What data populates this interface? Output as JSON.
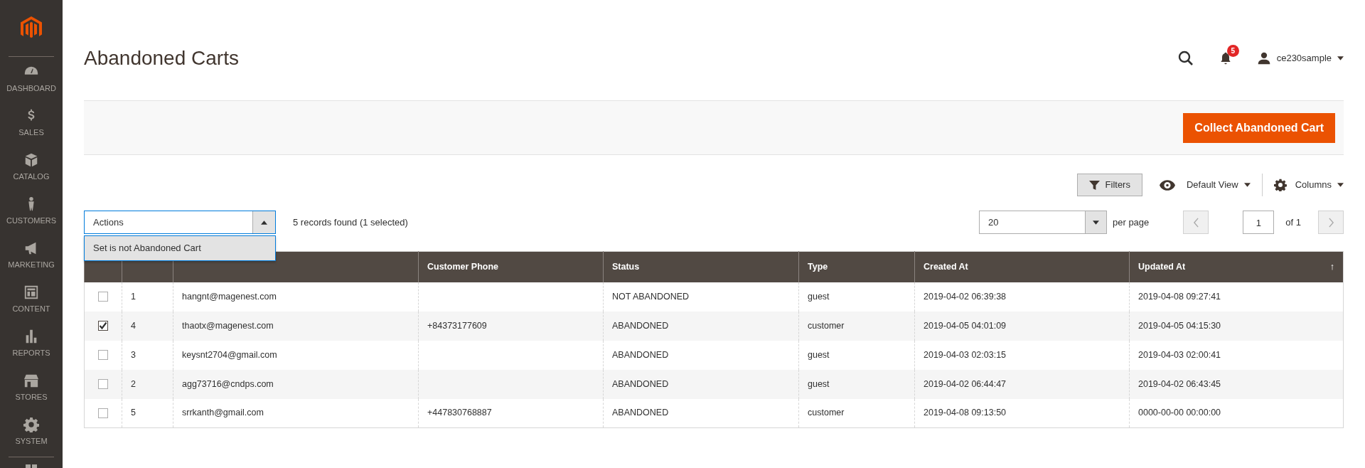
{
  "sidebar": {
    "items": [
      {
        "label": "DASHBOARD"
      },
      {
        "label": "SALES"
      },
      {
        "label": "CATALOG"
      },
      {
        "label": "CUSTOMERS"
      },
      {
        "label": "MARKETING"
      },
      {
        "label": "CONTENT"
      },
      {
        "label": "REPORTS"
      },
      {
        "label": "STORES"
      },
      {
        "label": "SYSTEM"
      }
    ]
  },
  "header": {
    "title": "Abandoned Carts",
    "notification_count": "5",
    "user": "ce230sample"
  },
  "action_bar": {
    "button": "Collect Abandoned Cart"
  },
  "toolbar": {
    "filters": "Filters",
    "view": "Default View",
    "columns": "Columns"
  },
  "mass_actions": {
    "label": "Actions",
    "expanded": true,
    "options": [
      "Set is not Abandoned Cart"
    ]
  },
  "records": "5 records found (1 selected)",
  "pager": {
    "per_page": "20",
    "per_page_label": "per page",
    "page": "1",
    "total": "of 1"
  },
  "table": {
    "columns": [
      {},
      {},
      {
        "label": "Customer Phone"
      },
      {
        "label": "Status"
      },
      {
        "label": "Type"
      },
      {
        "label": "Created At"
      },
      {
        "label": "Updated At",
        "sort": "↑"
      }
    ],
    "rows": [
      {
        "selected": false,
        "cells": [
          "1",
          "hangnt@magenest.com",
          "",
          "NOT ABANDONED",
          "guest",
          "2019-04-02 06:39:38",
          "2019-04-08 09:27:41"
        ]
      },
      {
        "selected": true,
        "cells": [
          "4",
          "thaotx@magenest.com",
          "+84373177609",
          "ABANDONED",
          "customer",
          "2019-04-05 04:01:09",
          "2019-04-05 04:15:30"
        ]
      },
      {
        "selected": false,
        "cells": [
          "3",
          "keysnt2704@gmail.com",
          "",
          "ABANDONED",
          "guest",
          "2019-04-03 02:03:15",
          "2019-04-03 02:00:41"
        ]
      },
      {
        "selected": false,
        "cells": [
          "2",
          "agg73716@cndps.com",
          "",
          "ABANDONED",
          "guest",
          "2019-04-02 06:44:47",
          "2019-04-02 06:43:45"
        ]
      },
      {
        "selected": false,
        "cells": [
          "5",
          "srrkanth@gmail.com",
          "+447830768887",
          "ABANDONED",
          "customer",
          "2019-04-08 09:13:50",
          "0000-00-00 00:00:00"
        ]
      }
    ]
  }
}
